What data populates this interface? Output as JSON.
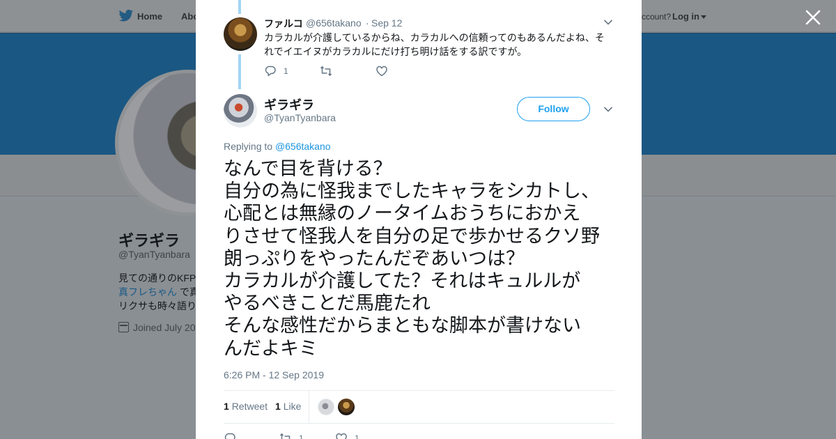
{
  "background_page": {
    "nav": {
      "home": "Home",
      "about": "Abo",
      "account_prompt": "ccount?",
      "login": "Log in"
    },
    "profile": {
      "name": "ギラギラ",
      "handle": "@TyanTyanbara",
      "bio_line1": "見ての通りのKFP",
      "bio_line2_link": "真フレちゃん",
      "bio_line2_rest": " で真",
      "bio_line3": "リクサも時々語り",
      "joined": "Joined July 20"
    }
  },
  "parent_tweet": {
    "author_name": "ファルコ",
    "author_handle": "@656takano",
    "dot": "·",
    "date": "Sep 12",
    "text": "カラカルが介護しているからね、カラカルへの信頼ってのもあるんだよね、それでイエイヌがカラカルにだけ打ち明け話をする訳ですが。",
    "reply_count": "1"
  },
  "main_tweet": {
    "author_name": "ギラギラ",
    "author_handle": "@TyanTyanbara",
    "follow_label": "Follow",
    "replying_prefix": "Replying to ",
    "replying_to": "@656takano",
    "text": "なんで目を背ける？\n自分の為に怪我までしたキャラをシカトし、\n心配とは無縁のノータイムおうちにおかえ\nりさせて怪我人を自分の足で歩かせるクソ野\n朗っぷりをやったんだぞあいつは？\nカラカルが介護してた？それはキュルルが\nやるべきことだ馬鹿たれ\nそんな感性だからまともな脚本が書けない\nんだよキミ",
    "timestamp": "6:26 PM - 12 Sep 2019",
    "retweet_count": "1",
    "retweet_label": "Retweet",
    "like_count": "1",
    "like_label": "Like",
    "bottom_retweet_count": "1",
    "bottom_like_count": "1"
  },
  "colors": {
    "accent": "#1da1f2",
    "thread_line": "#a3d5f5",
    "muted": "#657786"
  }
}
